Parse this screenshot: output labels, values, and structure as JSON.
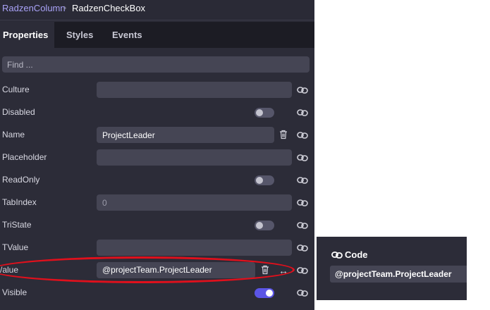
{
  "breadcrumb": {
    "parent": "RadzenColumn",
    "separator": "›",
    "current": "RadzenCheckBox"
  },
  "tabs": [
    {
      "label": "Properties",
      "active": true
    },
    {
      "label": "Styles",
      "active": false
    },
    {
      "label": "Events",
      "active": false
    }
  ],
  "search": {
    "placeholder": "Find ..."
  },
  "properties": [
    {
      "label": "Culture",
      "kind": "text",
      "value": ""
    },
    {
      "label": "Disabled",
      "kind": "toggle",
      "value": false
    },
    {
      "label": "Name",
      "kind": "text",
      "value": "ProjectLeader"
    },
    {
      "label": "Placeholder",
      "kind": "text",
      "value": ""
    },
    {
      "label": "ReadOnly",
      "kind": "toggle",
      "value": false
    },
    {
      "label": "TabIndex",
      "kind": "number",
      "value": "0"
    },
    {
      "label": "TriState",
      "kind": "toggle",
      "value": false
    },
    {
      "label": "TValue",
      "kind": "text",
      "value": ""
    },
    {
      "label": "Value",
      "kind": "binding",
      "value": "@projectTeam.ProjectLeader",
      "visible_label": "/alue"
    },
    {
      "label": "Visible",
      "kind": "toggle",
      "value": true
    }
  ],
  "code_panel": {
    "title": "Code",
    "value": "@projectTeam.ProjectLeader"
  },
  "icons": {
    "link": "link-icon",
    "trash": "trash-icon",
    "swap": "swap-arrows-icon"
  },
  "colors": {
    "accent": "#5b55e6",
    "highlight": "#e0101c",
    "panel": "#2c2c38"
  }
}
